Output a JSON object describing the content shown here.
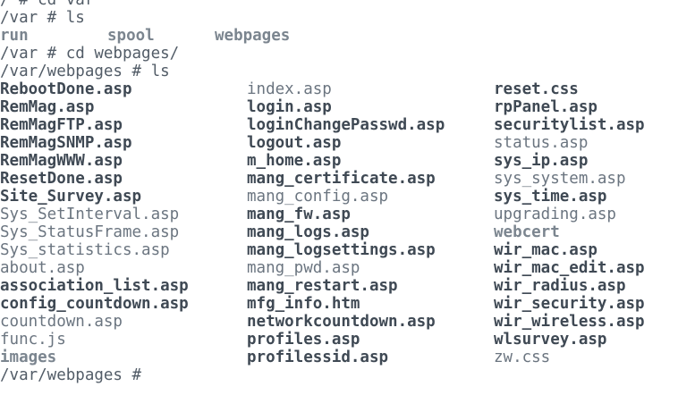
{
  "terminal": {
    "lines": [
      {
        "type": "prompt",
        "text": "/ # cd var"
      },
      {
        "type": "prompt",
        "text": "/var # ls"
      },
      {
        "type": "list",
        "items": [
          {
            "text": "run",
            "style": "dir"
          },
          {
            "text": "spool",
            "style": "dir"
          },
          {
            "text": "webpages",
            "style": "dir"
          }
        ]
      },
      {
        "type": "prompt",
        "text": "/var # cd webpages/"
      },
      {
        "type": "prompt",
        "text": "/var/webpages # ls"
      }
    ],
    "listing": {
      "columns": [
        [
          {
            "text": "RebootDone.asp",
            "style": "exec"
          },
          {
            "text": "RemMag.asp",
            "style": "exec"
          },
          {
            "text": "RemMagFTP.asp",
            "style": "exec"
          },
          {
            "text": "RemMagSNMP.asp",
            "style": "exec"
          },
          {
            "text": "RemMagWWW.asp",
            "style": "exec"
          },
          {
            "text": "ResetDone.asp",
            "style": "exec"
          },
          {
            "text": "Site_Survey.asp",
            "style": "exec"
          },
          {
            "text": "Sys_SetInterval.asp",
            "style": "normal"
          },
          {
            "text": "Sys_StatusFrame.asp",
            "style": "normal"
          },
          {
            "text": "Sys_statistics.asp",
            "style": "normal"
          },
          {
            "text": "about.asp",
            "style": "normal"
          },
          {
            "text": "association_list.asp",
            "style": "exec"
          },
          {
            "text": "config_countdown.asp",
            "style": "exec"
          },
          {
            "text": "countdown.asp",
            "style": "normal"
          },
          {
            "text": "func.js",
            "style": "normal"
          },
          {
            "text": "images",
            "style": "dir"
          }
        ],
        [
          {
            "text": "index.asp",
            "style": "normal"
          },
          {
            "text": "login.asp",
            "style": "exec"
          },
          {
            "text": "loginChangePasswd.asp",
            "style": "exec"
          },
          {
            "text": "logout.asp",
            "style": "exec"
          },
          {
            "text": "m_home.asp",
            "style": "exec"
          },
          {
            "text": "mang_certificate.asp",
            "style": "exec"
          },
          {
            "text": "mang_config.asp",
            "style": "normal"
          },
          {
            "text": "mang_fw.asp",
            "style": "exec"
          },
          {
            "text": "mang_logs.asp",
            "style": "exec"
          },
          {
            "text": "mang_logsettings.asp",
            "style": "exec"
          },
          {
            "text": "mang_pwd.asp",
            "style": "normal"
          },
          {
            "text": "mang_restart.asp",
            "style": "exec"
          },
          {
            "text": "mfg_info.htm",
            "style": "exec"
          },
          {
            "text": "networkcountdown.asp",
            "style": "exec"
          },
          {
            "text": "profiles.asp",
            "style": "exec"
          },
          {
            "text": "profilessid.asp",
            "style": "exec"
          }
        ],
        [
          {
            "text": "reset.css",
            "style": "exec"
          },
          {
            "text": "rpPanel.asp",
            "style": "exec"
          },
          {
            "text": "securitylist.asp",
            "style": "exec"
          },
          {
            "text": "status.asp",
            "style": "normal"
          },
          {
            "text": "sys_ip.asp",
            "style": "exec"
          },
          {
            "text": "sys_system.asp",
            "style": "normal"
          },
          {
            "text": "sys_time.asp",
            "style": "exec"
          },
          {
            "text": "upgrading.asp",
            "style": "normal"
          },
          {
            "text": "webcert",
            "style": "dir"
          },
          {
            "text": "wir_mac.asp",
            "style": "exec"
          },
          {
            "text": "wir_mac_edit.asp",
            "style": "exec"
          },
          {
            "text": "wir_radius.asp",
            "style": "exec"
          },
          {
            "text": "wir_security.asp",
            "style": "exec"
          },
          {
            "text": "wir_wireless.asp",
            "style": "exec"
          },
          {
            "text": "wlsurvey.asp",
            "style": "exec"
          },
          {
            "text": "zw.css",
            "style": "normal"
          }
        ]
      ]
    },
    "final_prompt": "/var/webpages # "
  }
}
